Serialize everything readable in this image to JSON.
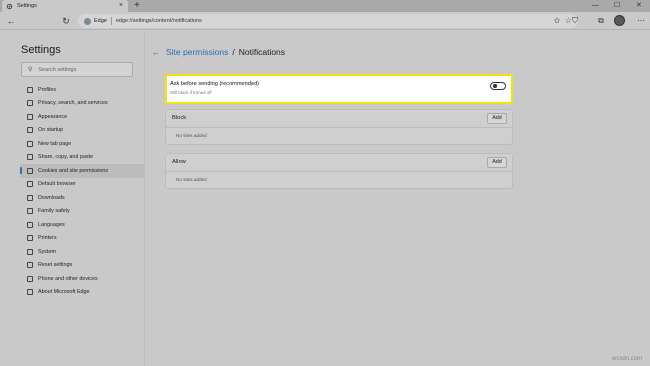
{
  "tab": {
    "title": "Settings",
    "close": "×",
    "new_tab": "+"
  },
  "window_controls": {
    "minimize": "—",
    "maximize": "☐",
    "close": "✕"
  },
  "toolbar": {
    "back": "←",
    "refresh": "↻",
    "address_brand": "Edge",
    "url": "edge://settings/content/notifications",
    "favorite_icon": "☆",
    "collections_icon": "⊡",
    "shield_icon": "⛉",
    "favorites_bar_icon": "✩",
    "tab_icon": "⧉",
    "menu_icon": "⋯"
  },
  "sidebar": {
    "title": "Settings",
    "search_placeholder": "Search settings",
    "items": [
      {
        "label": "Profiles",
        "active": false
      },
      {
        "label": "Privacy, search, and services",
        "active": false
      },
      {
        "label": "Appearance",
        "active": false
      },
      {
        "label": "On startup",
        "active": false
      },
      {
        "label": "New tab page",
        "active": false
      },
      {
        "label": "Share, copy, and paste",
        "active": false
      },
      {
        "label": "Cookies and site permissions",
        "active": true
      },
      {
        "label": "Default browser",
        "active": false
      },
      {
        "label": "Downloads",
        "active": false
      },
      {
        "label": "Family safety",
        "active": false
      },
      {
        "label": "Languages",
        "active": false
      },
      {
        "label": "Printers",
        "active": false
      },
      {
        "label": "System",
        "active": false
      },
      {
        "label": "Reset settings",
        "active": false
      },
      {
        "label": "Phone and other devices",
        "active": false
      },
      {
        "label": "About Microsoft Edge",
        "active": false
      }
    ]
  },
  "main": {
    "breadcrumb_back": "←",
    "breadcrumb_parent": "Site permissions",
    "breadcrumb_sep": "/",
    "breadcrumb_current": "Notifications",
    "ask": {
      "title": "Ask before sending (recommended)",
      "subtitle": "Will block if turned off",
      "toggle_on": false
    },
    "block": {
      "header": "Block",
      "add": "Add",
      "empty": "No sites added"
    },
    "allow": {
      "header": "Allow",
      "add": "Add",
      "empty": "No sites added"
    }
  },
  "watermark": "wsxdn.com",
  "colors": {
    "accent": "#2b6fb3",
    "highlight_border": "#f2e40a",
    "background": "#c9c9c9"
  }
}
